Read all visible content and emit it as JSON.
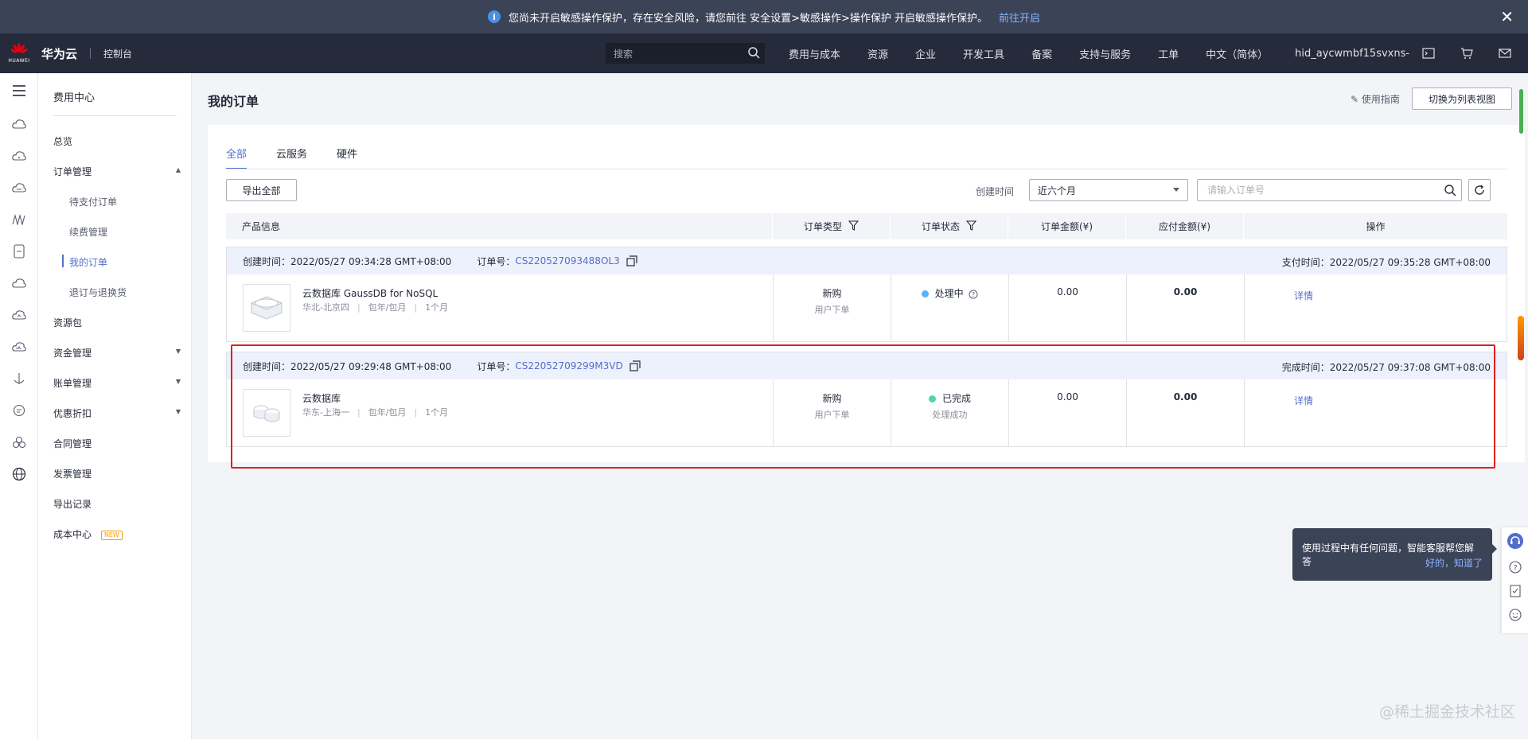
{
  "notice": {
    "text": "您尚未开启敏感操作保护，存在安全风险，请您前往 安全设置>敏感操作>操作保护 开启敏感操作保护。",
    "link": "前往开启"
  },
  "topnav": {
    "logo_small": "HUAWEI",
    "brand": "华为云",
    "console": "控制台",
    "search_placeholder": "搜索",
    "links": [
      "费用与成本",
      "资源",
      "企业",
      "开发工具",
      "备案",
      "支持与服务",
      "工单",
      "中文（简体）",
      "hid_aycwmbf15svxns-"
    ]
  },
  "sidebar": {
    "title": "费用中心",
    "overview": "总览",
    "order_mgmt": "订单管理",
    "sub": [
      "待支付订单",
      "续费管理",
      "我的订单",
      "退订与退换货"
    ],
    "items": [
      "资源包",
      "资金管理",
      "账单管理",
      "优惠折扣",
      "合同管理",
      "发票管理",
      "导出记录",
      "成本中心"
    ],
    "new_badge": "NEW"
  },
  "main": {
    "title": "我的订单",
    "guide": "使用指南",
    "switch": "切换为列表视图",
    "tabs": [
      "全部",
      "云服务",
      "硬件"
    ],
    "export": "导出全部",
    "ctime_label": "创建时间",
    "ctime_value": "近六个月",
    "order_placeholder": "请输入订单号",
    "columns": [
      "产品信息",
      "订单类型",
      "订单状态",
      "订单金额(¥)",
      "应付金额(¥)",
      "操作"
    ]
  },
  "orders": [
    {
      "created": "创建时间：2022/05/27 09:34:28 GMT+08:00",
      "no_label": "订单号：",
      "no": "CS220527093488OL3",
      "right": "支付时间：2022/05/27 09:35:28 GMT+08:00",
      "product": "云数据库 GaussDB for NoSQL",
      "region": "华北-北京四",
      "billing": "包年/包月",
      "duration": "1个月",
      "type": "新购",
      "type_sub": "用户下单",
      "status": "处理中",
      "status_sub": "",
      "status_color": "#5eb1f2",
      "amount": "0.00",
      "payable": "0.00",
      "action": "详情"
    },
    {
      "created": "创建时间：2022/05/27 09:29:48 GMT+08:00",
      "no_label": "订单号：",
      "no": "CS22052709299M3VD",
      "right": "完成时间：2022/05/27 09:37:08 GMT+08:00",
      "product": "云数据库",
      "region": "华东-上海一",
      "billing": "包年/包月",
      "duration": "1个月",
      "type": "新购",
      "type_sub": "用户下单",
      "status": "已完成",
      "status_sub": "处理成功",
      "status_color": "#50d4ab",
      "amount": "0.00",
      "payable": "0.00",
      "action": "详情"
    }
  ],
  "tooltip": {
    "text": "使用过程中有任何问题，智能客服帮您解答",
    "ok": "好的，知道了"
  },
  "watermark": "@稀土掘金技术社区"
}
